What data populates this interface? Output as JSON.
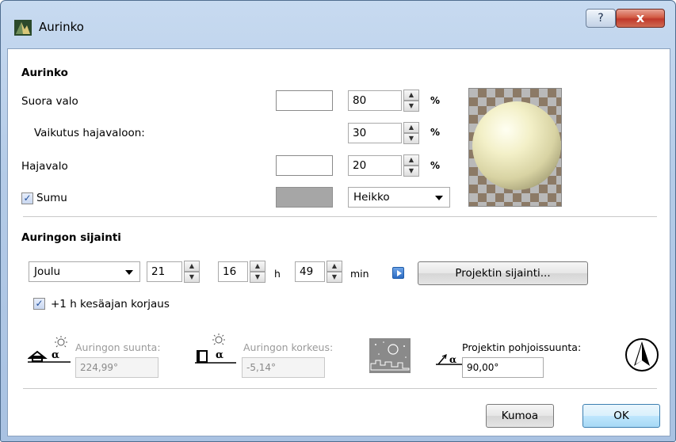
{
  "window": {
    "title": "Aurinko",
    "help_label": "?",
    "close_label": "x"
  },
  "sun": {
    "heading": "Aurinko",
    "direct_light": {
      "label": "Suora valo",
      "value": "80",
      "unit": "%"
    },
    "diffuse_effect": {
      "label": "Vaikutus hajavaloon:",
      "value": "30",
      "unit": "%"
    },
    "ambient_light": {
      "label": "Hajavalo",
      "value": "20",
      "unit": "%"
    },
    "fog": {
      "label": "Sumu",
      "checked": true,
      "density": "Heikko"
    }
  },
  "position": {
    "heading": "Auringon sijainti",
    "month": "Joulu",
    "day": "21",
    "hour": "16",
    "hour_unit": "h",
    "minute": "49",
    "minute_unit": "min",
    "project_location_button": "Projektin sijainti...",
    "dst": {
      "label": "+1 h kesäajan korjaus",
      "checked": true
    },
    "azimuth": {
      "label": "Auringon suunta:",
      "value": "224,99°"
    },
    "altitude": {
      "label": "Auringon korkeus:",
      "value": "-5,14°"
    },
    "north": {
      "label": "Projektin pohjoissuunta:",
      "value": "90,00°"
    }
  },
  "footer": {
    "cancel_label": "Kumoa",
    "ok_label": "OK"
  },
  "colors": {
    "close_red": "#c0392b",
    "fog_gray": "#a6a6a6",
    "sphere": "#f3f0c8"
  }
}
